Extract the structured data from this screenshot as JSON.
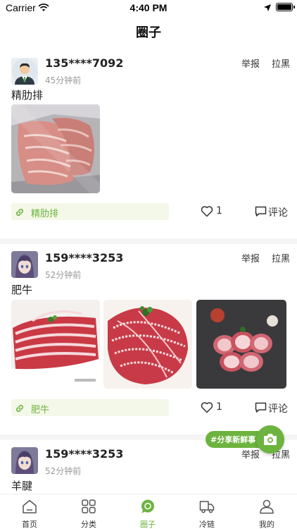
{
  "status_bar": {
    "carrier": "Carrier",
    "time": "4:40 PM"
  },
  "header": {
    "title": "圈子"
  },
  "actions": {
    "report": "举报",
    "block": "拉黑",
    "comment": "评论"
  },
  "posts": [
    {
      "username": "135****7092",
      "time": "45分钟前",
      "text": "精肋排",
      "tag": "精肋排",
      "likes": "1",
      "avatar_icon": "businessman-avatar"
    },
    {
      "username": "159****3253",
      "time": "52分钟前",
      "text": "肥牛",
      "tag": "肥牛",
      "likes": "1",
      "avatar_icon": "anime-avatar"
    },
    {
      "username": "159****3253",
      "time": "52分钟前",
      "text": "羊腱",
      "avatar_icon": "anime-avatar"
    }
  ],
  "fab": {
    "label": "#分享新鲜事",
    "icon": "camera-icon"
  },
  "tabbar": {
    "items": [
      {
        "label": "首页",
        "icon": "home-icon"
      },
      {
        "label": "分类",
        "icon": "grid-icon"
      },
      {
        "label": "圈子",
        "icon": "chat-bubble-icon",
        "active": true
      },
      {
        "label": "冷链",
        "icon": "truck-icon"
      },
      {
        "label": "我的",
        "icon": "user-icon"
      }
    ]
  },
  "colors": {
    "accent": "#6db33f",
    "tag_bg": "#f4f8e8",
    "meat_red": "#c23a4a"
  }
}
